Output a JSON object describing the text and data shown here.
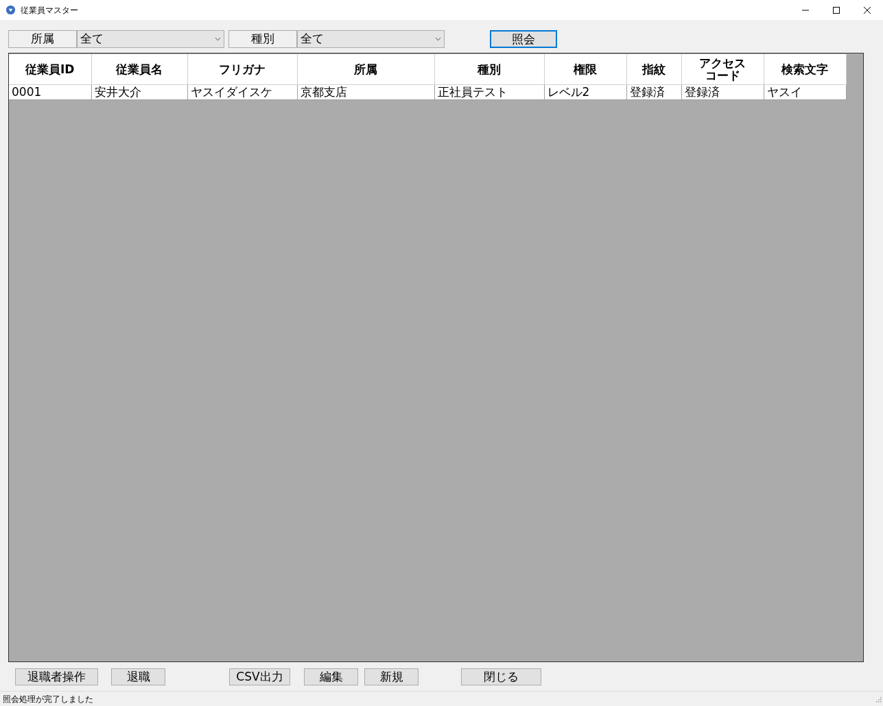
{
  "window": {
    "title": "従業員マスター"
  },
  "filters": [
    {
      "label": "所属",
      "value": "全て"
    },
    {
      "label": "種別",
      "value": "全て"
    }
  ],
  "query_button": "照会",
  "table": {
    "columns": [
      "従業員ID",
      "従業員名",
      "フリガナ",
      "所属",
      "種別",
      "権限",
      "指紋",
      "アクセスコード",
      "検索文字"
    ],
    "rows": [
      [
        "0001",
        "安井大介",
        "ヤスイダイスケ",
        "京都支店",
        "正社員テスト",
        "レベル2",
        "登録済",
        "登録済",
        "ヤスイ"
      ]
    ]
  },
  "bottom_buttons": [
    "退職者操作",
    "退職",
    "CSV出力",
    "編集",
    "新規",
    "閉じる"
  ],
  "status_bar": "照会処理が完了しました"
}
